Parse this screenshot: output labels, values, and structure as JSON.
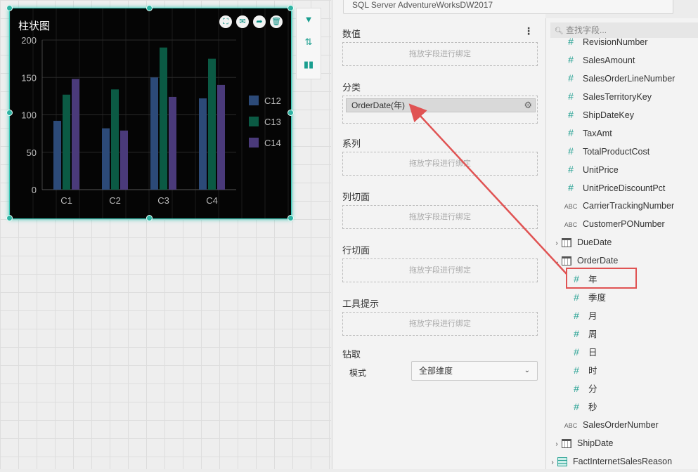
{
  "widget": {
    "title": "柱状图",
    "buttons": [
      "fullscreen-icon",
      "comment-icon",
      "share-icon",
      "delete-icon"
    ]
  },
  "chart_data": {
    "type": "bar",
    "categories": [
      "C1",
      "C2",
      "C3",
      "C4"
    ],
    "series": [
      {
        "name": "C12",
        "values": [
          92,
          82,
          150,
          122
        ],
        "color": "#2c4a78"
      },
      {
        "name": "C13",
        "values": [
          127,
          134,
          190,
          175
        ],
        "color": "#0b5a44"
      },
      {
        "name": "C14",
        "values": [
          148,
          79,
          124,
          140
        ],
        "color": "#4a3a7a"
      }
    ],
    "ylim": [
      0,
      200
    ],
    "yticks": [
      0,
      50,
      100,
      150,
      200
    ],
    "grid": true,
    "legend": "right"
  },
  "vertical_toolbar": [
    "filter-icon",
    "sort-icon",
    "chart-type-icon"
  ],
  "props": {
    "datasource": "SQL Server AdventureWorksDW2017",
    "placeholder": "拖放字段进行绑定",
    "values_label": "数值",
    "category_label": "分类",
    "category_field": "OrderDate(年)",
    "series_label": "系列",
    "col_slice_label": "列切面",
    "row_slice_label": "行切面",
    "tooltip_label": "工具提示",
    "drill_label": "钻取",
    "mode_label": "模式",
    "mode_value": "全部维度"
  },
  "fields": {
    "search_placeholder": "查找字段...",
    "items": [
      {
        "type": "num",
        "label": "RevisionNumber"
      },
      {
        "type": "num",
        "label": "SalesAmount"
      },
      {
        "type": "num",
        "label": "SalesOrderLineNumber"
      },
      {
        "type": "num",
        "label": "SalesTerritoryKey"
      },
      {
        "type": "num",
        "label": "ShipDateKey"
      },
      {
        "type": "num",
        "label": "TaxAmt"
      },
      {
        "type": "num",
        "label": "TotalProductCost"
      },
      {
        "type": "num",
        "label": "UnitPrice"
      },
      {
        "type": "num",
        "label": "UnitPriceDiscountPct"
      },
      {
        "type": "abc",
        "label": "CarrierTrackingNumber"
      },
      {
        "type": "abc",
        "label": "CustomerPONumber"
      },
      {
        "type": "date",
        "label": "DueDate",
        "expand": "collapsed"
      },
      {
        "type": "date",
        "label": "OrderDate",
        "expand": "expanded"
      },
      {
        "type": "sub",
        "label": "年"
      },
      {
        "type": "sub",
        "label": "季度"
      },
      {
        "type": "sub",
        "label": "月"
      },
      {
        "type": "sub",
        "label": "周"
      },
      {
        "type": "sub",
        "label": "日"
      },
      {
        "type": "sub",
        "label": "时"
      },
      {
        "type": "sub",
        "label": "分"
      },
      {
        "type": "sub",
        "label": "秒"
      },
      {
        "type": "abc",
        "label": "SalesOrderNumber"
      },
      {
        "type": "date",
        "label": "ShipDate",
        "expand": "collapsed"
      },
      {
        "type": "table",
        "label": "FactInternetSalesReason",
        "expand": "collapsed"
      }
    ]
  }
}
